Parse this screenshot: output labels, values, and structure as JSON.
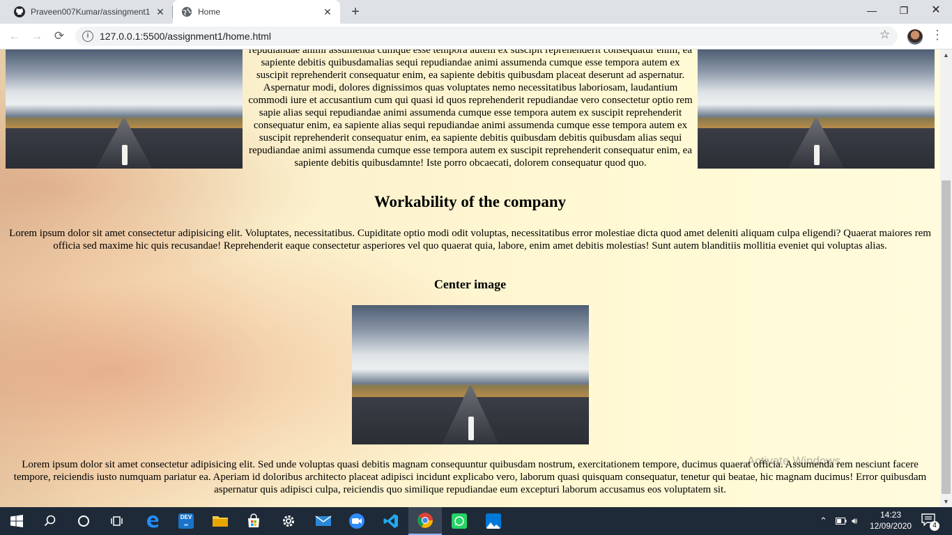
{
  "tabs": [
    {
      "title": "Praveen007Kumar/assingment1",
      "icon": "github-icon"
    },
    {
      "title": "Home",
      "icon": "globe-icon"
    }
  ],
  "address_bar": {
    "url": "127.0.0.1:5500/assignment1/home.html"
  },
  "page": {
    "top_paragraph": "repudiandae animi assumenda cumque esse tempora autem ex suscipit reprehenderit consequatur enim, ea sapiente debitis quibusdamalias sequi repudiandae animi assumenda cumque esse tempora autem ex suscipit reprehenderit consequatur enim, ea sapiente debitis quibusdam placeat deserunt ad aspernatur. Aspernatur modi, dolores dignissimos quas voluptates nemo necessitatibus laboriosam, laudantium commodi iure et accusantium cum qui quasi id quos reprehenderit repudiandae vero consectetur optio rem sapie alias sequi repudiandae animi assumenda cumque esse tempora autem ex suscipit reprehenderit consequatur enim, ea sapiente alias sequi repudiandae animi assumenda cumque esse tempora autem ex suscipit reprehenderit consequatur enim, ea sapiente debitis quibusdam debitis quibusdam alias sequi repudiandae animi assumenda cumque esse tempora autem ex suscipit reprehenderit consequatur enim, ea sapiente debitis quibusdamnte! Iste porro obcaecati, dolorem consequatur quod quo.",
    "heading_workability": "Workability of the company",
    "paragraph_1": "Lorem ipsum dolor sit amet consectetur adipisicing elit. Voluptates, necessitatibus. Cupiditate optio modi odit voluptas, necessitatibus error molestiae dicta quod amet deleniti aliquam culpa eligendi? Quaerat maiores rem officia sed maxime hic quis recusandae! Reprehenderit eaque consectetur asperiores vel quo quaerat quia, labore, enim amet debitis molestias! Sunt autem blanditiis mollitia eveniet qui voluptas alias.",
    "heading_center_image": "Center image",
    "paragraph_2": "Lorem ipsum dolor sit amet consectetur adipisicing elit. Sed unde voluptas quasi debitis magnam consequuntur quibusdam nostrum, exercitationem tempore, ducimus quaerat officia. Assumenda rem nesciunt facere tempore, reiciendis iusto numquam pariatur ea. Aperiam id doloribus architecto placeat adipisci incidunt explicabo vero, laborum quasi quisquam consequatur, tenetur qui beatae, hic magnam ducimus! Error quibusdam aspernatur quis adipisci culpa, reiciendis quo similique repudiandae eum excepturi laborum accusamus eos voluptatem sit."
  },
  "watermark": "Activate Windows",
  "taskbar": {
    "apps": [
      "windows-start-icon",
      "search-icon",
      "cortana-icon",
      "task-view-icon",
      "edge-icon",
      "dev-icon",
      "file-explorer-icon",
      "store-icon",
      "settings-icon",
      "mail-icon",
      "zoom-icon",
      "vscode-icon",
      "chrome-icon",
      "whatsapp-icon",
      "photos-icon"
    ],
    "time": "14:23",
    "date": "12/09/2020",
    "notification_count": "4"
  },
  "colors": {
    "taskbar": "#1f2a38",
    "tabstrip": "#dee1e6",
    "page_bg": "#fff8d2"
  }
}
